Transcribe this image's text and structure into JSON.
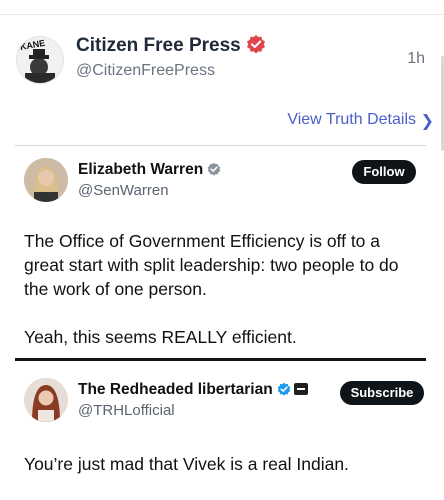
{
  "post": {
    "author_name": "Citizen Free Press",
    "author_handle": "@CitizenFreePress",
    "time": "1h",
    "avatar_text": "KANE",
    "view_details": "View Truth Details",
    "verified_color": "#e0464d",
    "link_color": "#4b5fc9"
  },
  "embed_1": {
    "name": "Elizabeth Warren",
    "handle": "@SenWarren",
    "button": "Follow",
    "body_line_1": "The Office of Government Efficiency is off to a great start with split leadership:  two people to do the work of one person.",
    "body_line_2": "Yeah, this seems REALLY efficient."
  },
  "embed_2": {
    "name": "The Redheaded libertarian",
    "handle": "@TRHLofficial",
    "button": "Subscribe",
    "body": "You’re just mad that Vivek is a real Indian."
  }
}
